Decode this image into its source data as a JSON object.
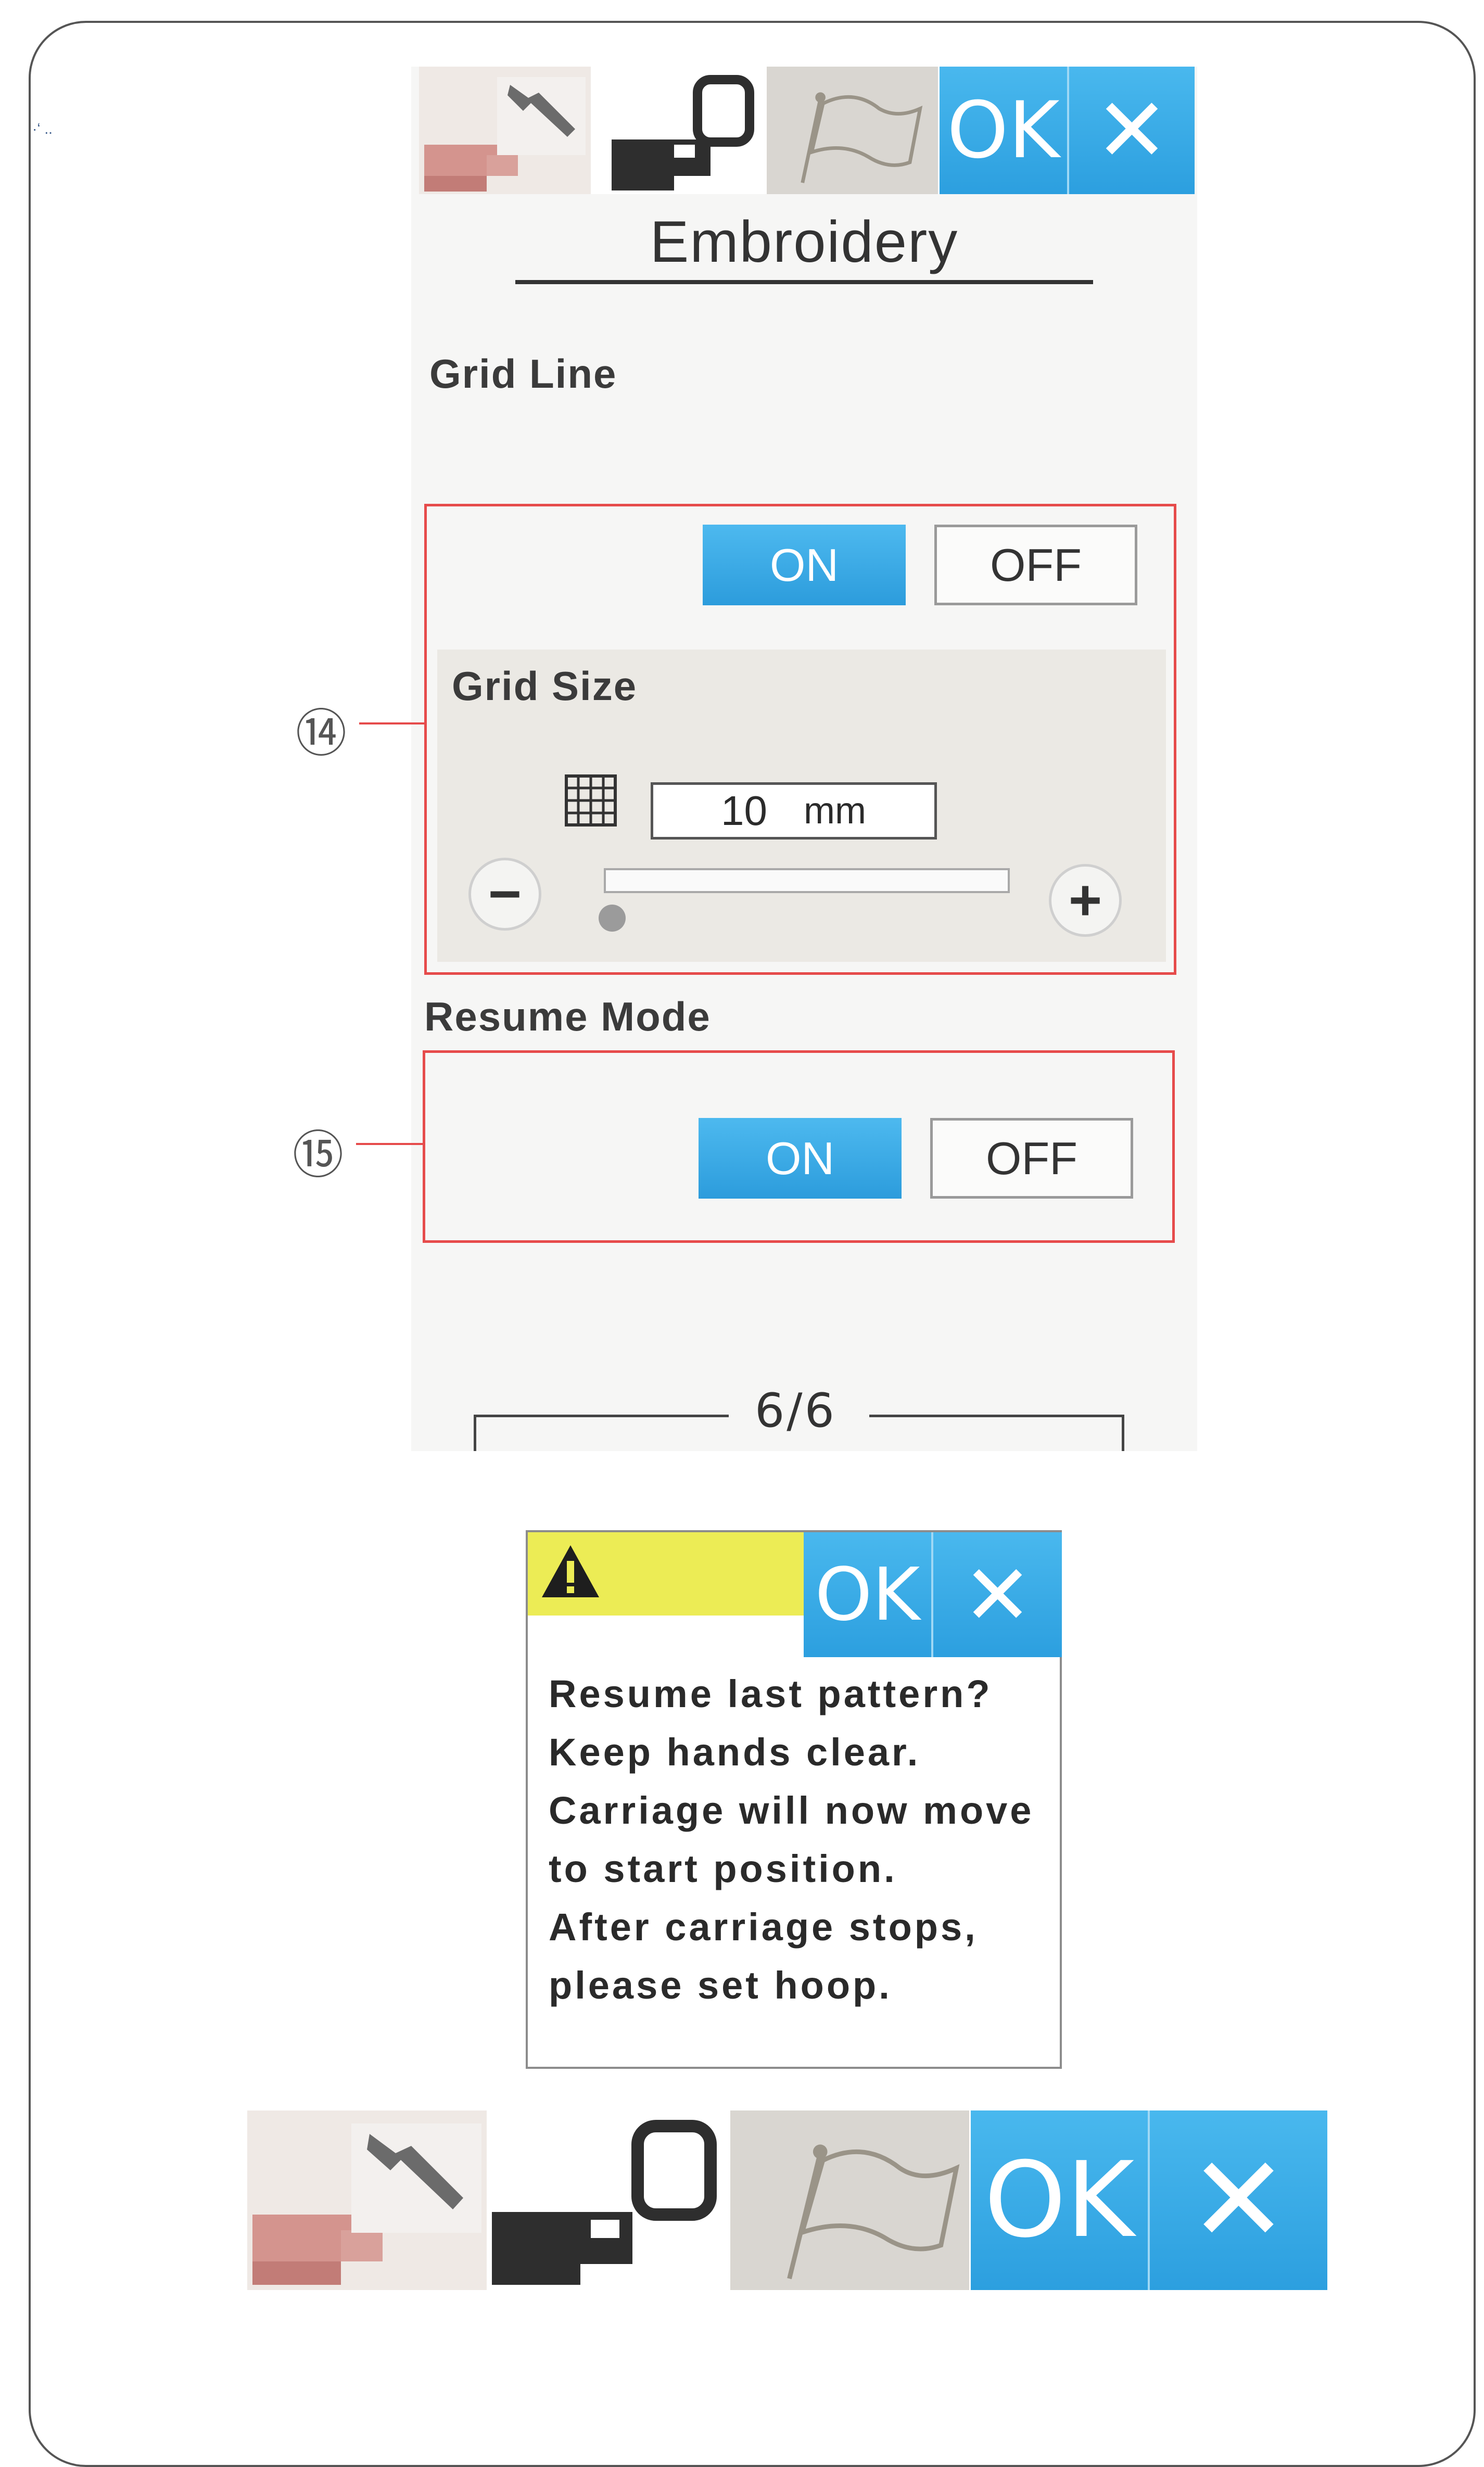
{
  "top_screen": {
    "toolbar": {
      "machine_settings_tab": "machine-settings",
      "embroidery_settings_tab": "embroidery-settings",
      "language_tab": "language-flag",
      "ok_label": "OK",
      "cancel_label": "✕"
    },
    "title": "Embroidery",
    "grid_line": {
      "label": "Grid Line",
      "on_label": "ON",
      "off_label": "OFF",
      "selected": "ON",
      "callout": "⑭"
    },
    "grid_size": {
      "label": "Grid Size",
      "value": "10",
      "unit": "mm",
      "minus_label": "−",
      "plus_label": "+",
      "slider_position": 0
    },
    "resume_mode": {
      "label": "Resume Mode",
      "on_label": "ON",
      "off_label": "OFF",
      "selected": "ON",
      "callout": "⑮"
    },
    "page_indicator": "6/6"
  },
  "dialog": {
    "warning_icon": "warning-triangle",
    "ok_label": "OK",
    "cancel_label": "✕",
    "message_lines": [
      "Resume last pattern?",
      "Keep hands clear.",
      "Carriage will now move",
      "to start position.",
      "After carriage stops,",
      "please set hoop."
    ]
  },
  "bottom_toolbar": {
    "machine_settings_tab": "machine-settings",
    "embroidery_settings_tab": "embroidery-settings",
    "language_tab": "language-flag",
    "ok_label": "OK",
    "cancel_label": "✕"
  },
  "colors": {
    "accent_blue": "#2c9fdf",
    "highlight_red": "#e64b4b",
    "warning_yellow": "#ecec55"
  }
}
